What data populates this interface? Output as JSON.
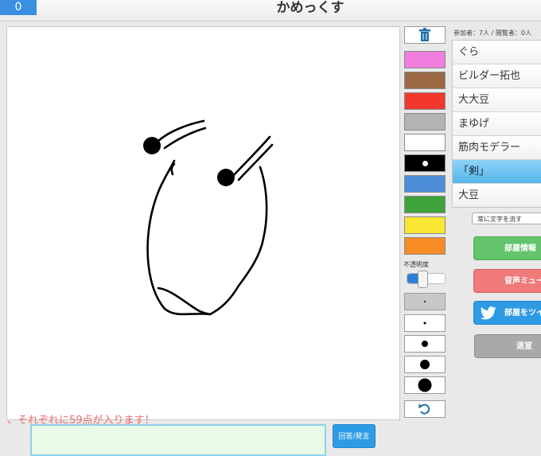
{
  "header": {
    "counter": "0",
    "title": "かめっくす"
  },
  "canvas": {
    "notice": "、それぞれに59点が入ります！",
    "stroke_color": "#000000"
  },
  "tools": {
    "trash_icon": "trash-icon",
    "colors": [
      "#ef7ede",
      "#9b6a45",
      "#f2382c",
      "#b3b3b3",
      "#ffffff",
      "#000000",
      "#4c8ed8",
      "#3da33a",
      "#f8e632",
      "#f78c24"
    ],
    "selected_color": "#000000",
    "opacity_label": "不透明度",
    "opacity_value": 0.35,
    "undo_icon": "undo-icon"
  },
  "participants": {
    "header": "参加者：7人 / 閲覧者：0人",
    "list": [
      {
        "name": "ぐら"
      },
      {
        "name": "ビルダー拓也"
      },
      {
        "name": "大大豆"
      },
      {
        "name": "まゆげ"
      },
      {
        "name": "筋肉モデラー"
      },
      {
        "name": "「剣」"
      },
      {
        "name": "大豆"
      }
    ],
    "highlighted_index": 5
  },
  "controls": {
    "flow_text": "常に文字を流す",
    "room_info": "部屋情報",
    "voice_mute": "音声ミュート",
    "tweet_room": "部屋をツイート",
    "leave": "退室"
  },
  "bottom": {
    "answer_value": "",
    "answer_button": "回答/発言"
  },
  "colors": {
    "accent": "#2e9be6",
    "header_counter": "#3a8fe0",
    "highlight": "#56b6ec"
  }
}
